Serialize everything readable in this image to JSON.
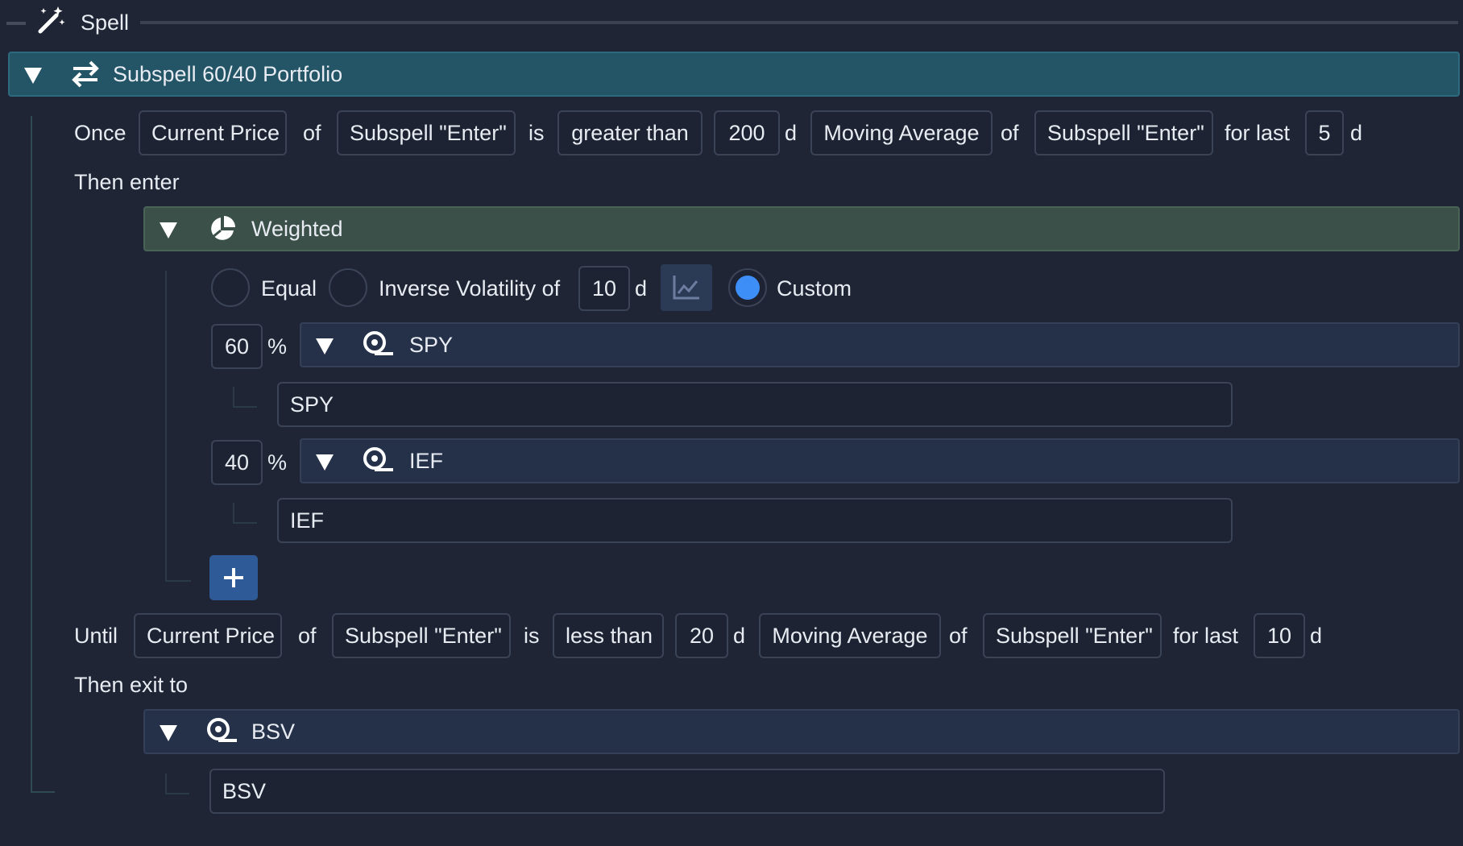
{
  "header": {
    "title": "Spell"
  },
  "subspell": {
    "title": "Subspell 60/40 Portfolio"
  },
  "entry_condition": {
    "prefix": "Once",
    "metric_a": "Current Price",
    "of_a": "of",
    "target_a": "Subspell \"Enter\"",
    "is": "is",
    "comparator": "greater than",
    "period": "200",
    "period_unit": "d",
    "metric_b": "Moving Average",
    "of_b": "of",
    "target_b": "Subspell \"Enter\"",
    "for_last": "for last",
    "lookback": "5",
    "lookback_unit": "d"
  },
  "then_enter": "Then enter",
  "weighted": {
    "title": "Weighted",
    "options": {
      "equal": "Equal",
      "inverse_volatility": "Inverse Volatility of",
      "inverse_period": "10",
      "inverse_unit": "d",
      "custom": "Custom"
    },
    "selected": "custom",
    "assets": [
      {
        "percent": "60",
        "percent_sign": "%",
        "ticker": "SPY",
        "input_value": "SPY"
      },
      {
        "percent": "40",
        "percent_sign": "%",
        "ticker": "IEF",
        "input_value": "IEF"
      }
    ]
  },
  "exit_condition": {
    "prefix": "Until",
    "metric_a": "Current Price",
    "of_a": "of",
    "target_a": "Subspell \"Enter\"",
    "is": "is",
    "comparator": "less than",
    "period": "20",
    "period_unit": "d",
    "metric_b": "Moving Average",
    "of_b": "of",
    "target_b": "Subspell \"Enter\"",
    "for_last": "for last",
    "lookback": "10",
    "lookback_unit": "d"
  },
  "then_exit": "Then exit to",
  "exit_asset": {
    "ticker": "BSV",
    "input_value": "BSV"
  },
  "colors": {
    "background": "#1f2535",
    "subspell_bar": "#235566",
    "weighted_bar": "#3a5048",
    "asset_bar": "#243149",
    "radio_selected": "#3e8ef7",
    "add_button": "#2e5a97"
  },
  "icons": {
    "header": "magic-wand-icon",
    "subspell": "swap-arrows-icon",
    "weighted": "pie-chart-icon",
    "asset": "ticker-icon",
    "chart_toggle": "line-chart-icon",
    "add": "plus-icon",
    "collapse": "triangle-down-icon"
  }
}
